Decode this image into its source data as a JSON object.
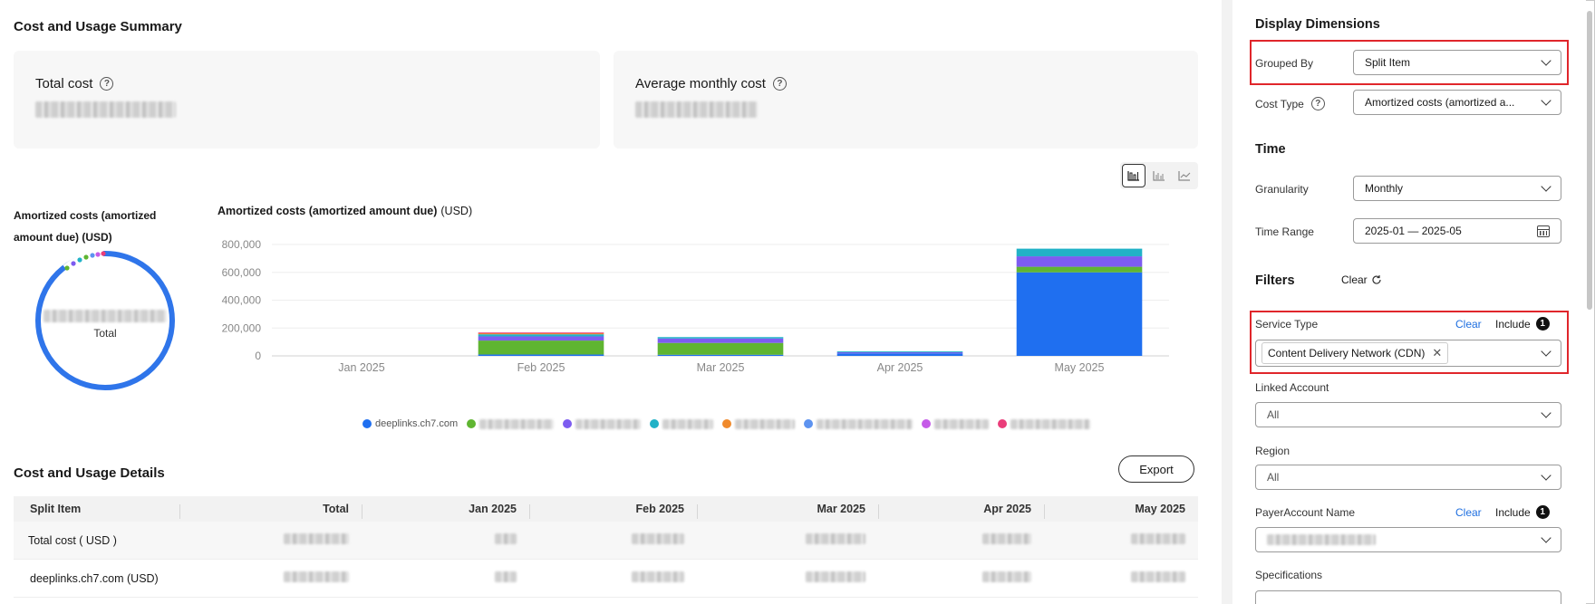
{
  "summary": {
    "title": "Cost and Usage Summary",
    "total_cost_label": "Total cost",
    "avg_monthly_label": "Average monthly cost"
  },
  "donut": {
    "title": "Amortized costs (amortized amount due) (USD)",
    "center_label": "Total",
    "accent": "#2f75ea"
  },
  "chart_title": "Amortized costs (amortized amount due)",
  "chart_unit": "(USD)",
  "chart_data": {
    "type": "bar",
    "stacked": true,
    "categories": [
      "Jan 2025",
      "Feb 2025",
      "Mar 2025",
      "Apr 2025",
      "May 2025"
    ],
    "yticks": [
      "800,000",
      "600,000",
      "400,000",
      "200,000",
      "0"
    ],
    "ylim": [
      0,
      800000
    ],
    "grid": true,
    "legend_position": "bottom",
    "series": [
      {
        "name": "deeplinks.ch7.com",
        "color": "#1f6ff0",
        "values": [
          0,
          10000,
          8000,
          18000,
          600000
        ]
      },
      {
        "name": "",
        "color": "#5fb531",
        "values": [
          0,
          100000,
          85000,
          0,
          40000
        ]
      },
      {
        "name": "",
        "color": "#7d5cf0",
        "values": [
          0,
          30000,
          32000,
          8000,
          75000
        ]
      },
      {
        "name": "",
        "color": "#21b2c7",
        "values": [
          0,
          15000,
          10000,
          6000,
          55000
        ]
      },
      {
        "name": "",
        "color": "#f08a2c",
        "values": [
          0,
          8000,
          0,
          0,
          0
        ]
      },
      {
        "name": "",
        "color": "#5d93f0",
        "values": [
          0,
          0,
          0,
          0,
          0
        ]
      },
      {
        "name": "",
        "color": "#c55be8",
        "values": [
          0,
          0,
          0,
          0,
          0
        ]
      },
      {
        "name": "",
        "color": "#ea3d7a",
        "values": [
          0,
          5000,
          0,
          0,
          0
        ]
      }
    ]
  },
  "details": {
    "title": "Cost and Usage Details",
    "export_label": "Export",
    "columns": [
      "Split Item",
      "Total",
      "Jan 2025",
      "Feb 2025",
      "Mar 2025",
      "Apr 2025",
      "May 2025"
    ],
    "rows": [
      {
        "label": "Total cost ( USD )"
      },
      {
        "label": "deeplinks.ch7.com (USD)"
      }
    ]
  },
  "sidebar": {
    "display_title": "Display Dimensions",
    "grouped_by_label": "Grouped By",
    "grouped_by_value": "Split Item",
    "cost_type_label": "Cost Type",
    "cost_type_value": "Amortized costs (amortized a...",
    "time_title": "Time",
    "granularity_label": "Granularity",
    "granularity_value": "Monthly",
    "time_range_label": "Time Range",
    "time_range_value": "2025-01 — 2025-05",
    "filters_title": "Filters",
    "filters_clear": "Clear",
    "service_type_label": "Service Type",
    "service_type_clear": "Clear",
    "service_type_include": "Include",
    "service_type_count": "1",
    "service_type_tag": "Content Delivery Network (CDN)",
    "linked_account_label": "Linked Account",
    "linked_account_value": "All",
    "region_label": "Region",
    "region_value": "All",
    "payer_label": "PayerAccount Name",
    "payer_clear": "Clear",
    "payer_include": "Include",
    "payer_count": "1",
    "specifications_label": "Specifications"
  }
}
